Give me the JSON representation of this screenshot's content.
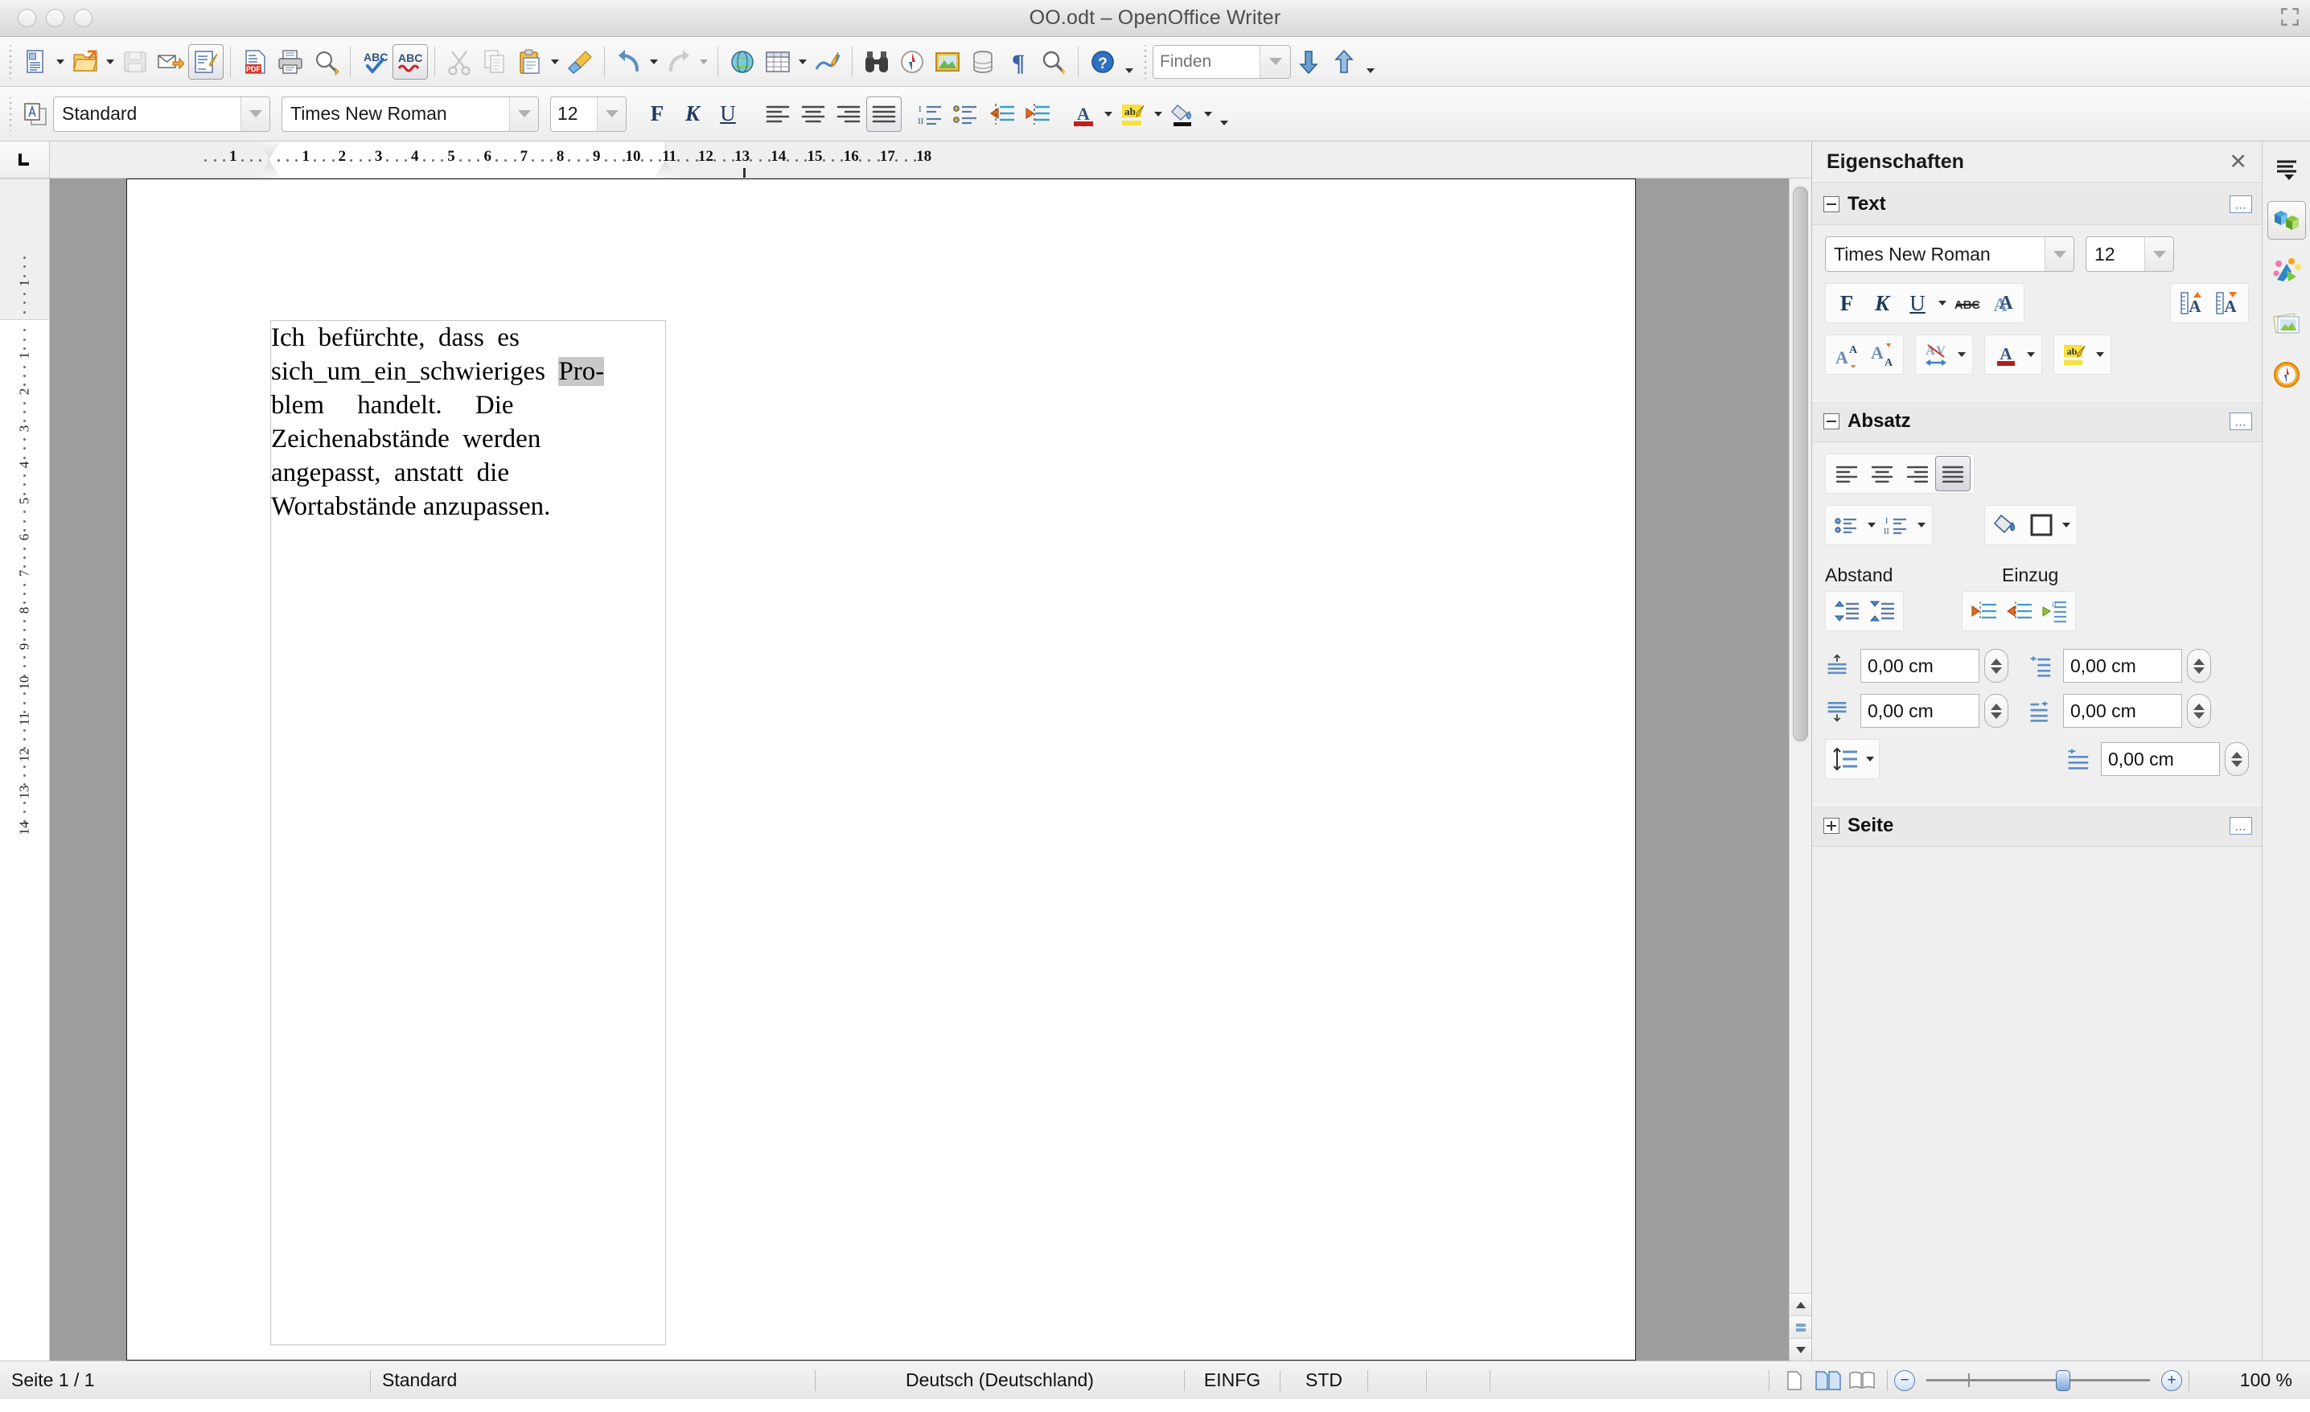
{
  "window": {
    "title": "OO.odt – OpenOffice Writer",
    "controls": [
      "close",
      "minimize",
      "zoom"
    ]
  },
  "main_toolbar": {
    "buttons": [
      {
        "name": "new-document",
        "icon": "new-doc-icon",
        "label": "Neu",
        "dropdown": true,
        "state": "enabled"
      },
      {
        "name": "open-document",
        "icon": "open-folder-icon",
        "label": "Öffnen",
        "dropdown": true,
        "state": "enabled"
      },
      {
        "name": "save-document",
        "icon": "save-floppy-icon",
        "label": "Speichern",
        "state": "disabled"
      },
      {
        "name": "send-email",
        "icon": "email-icon",
        "label": "Dokument als E-Mail",
        "state": "enabled"
      },
      {
        "name": "edit-mode",
        "icon": "edit-pencil-icon",
        "label": "Bearbeiten",
        "state": "active"
      },
      {
        "name": "export-pdf",
        "icon": "pdf-icon",
        "label": "Direktes Exportieren als PDF",
        "state": "enabled"
      },
      {
        "name": "print-document",
        "icon": "printer-icon",
        "label": "Datei direkt drucken",
        "state": "enabled"
      },
      {
        "name": "print-preview",
        "icon": "print-preview-icon",
        "label": "Seitenansicht",
        "state": "enabled"
      },
      {
        "name": "spellcheck",
        "icon": "abc-check-icon",
        "label": "Rechtschreibung",
        "state": "enabled"
      },
      {
        "name": "autospellcheck",
        "icon": "abc-wave-icon",
        "label": "Automatische Rechtschreibprüfung",
        "state": "active"
      },
      {
        "name": "cut",
        "icon": "scissors-icon",
        "label": "Ausschneiden",
        "state": "disabled"
      },
      {
        "name": "copy",
        "icon": "copy-icon",
        "label": "Kopieren",
        "state": "disabled"
      },
      {
        "name": "paste",
        "icon": "clipboard-icon",
        "label": "Einfügen",
        "dropdown": true,
        "state": "enabled"
      },
      {
        "name": "clone-formatting",
        "icon": "paintbrush-icon",
        "label": "Klonformatierung",
        "state": "enabled"
      },
      {
        "name": "undo",
        "icon": "undo-arrow-icon",
        "label": "Rückgängig",
        "dropdown": true,
        "state": "enabled"
      },
      {
        "name": "redo",
        "icon": "redo-arrow-icon",
        "label": "Wiederherstellen",
        "dropdown": true,
        "state": "disabled"
      },
      {
        "name": "hyperlink",
        "icon": "globe-icon",
        "label": "Hyperlink",
        "state": "enabled"
      },
      {
        "name": "insert-table",
        "icon": "table-grid-icon",
        "label": "Tabelle",
        "dropdown": true,
        "state": "enabled"
      },
      {
        "name": "show-draw-functions",
        "icon": "draw-pencil-icon",
        "label": "Zeichenfunktionen",
        "state": "enabled"
      },
      {
        "name": "find-replace",
        "icon": "binoculars-icon",
        "label": "Suchen & Ersetzen",
        "state": "enabled"
      },
      {
        "name": "navigator",
        "icon": "compass-icon",
        "label": "Navigator",
        "state": "enabled"
      },
      {
        "name": "gallery",
        "icon": "gallery-picture-icon",
        "label": "Gallery",
        "state": "enabled"
      },
      {
        "name": "data-sources",
        "icon": "database-icon",
        "label": "Datenquellen",
        "state": "enabled"
      },
      {
        "name": "formatting-marks",
        "icon": "pilcrow-icon",
        "label": "Formatierungszeichen",
        "state": "enabled"
      },
      {
        "name": "zoom",
        "icon": "magnifier-icon",
        "label": "Maßstab",
        "state": "enabled"
      },
      {
        "name": "help",
        "icon": "help-question-icon",
        "label": "Hilfe",
        "state": "enabled"
      }
    ],
    "find": {
      "placeholder": "Finden",
      "value": "",
      "find-next": "Abwärts suchen",
      "find-prev": "Aufwärts suchen"
    }
  },
  "format_toolbar": {
    "style_apply_icon": "style-apply-icon",
    "paragraph_style": "Standard",
    "font_name": "Times New Roman",
    "font_size": "12",
    "bold": "F",
    "italic": "K",
    "underline": "U",
    "buttons": [
      {
        "name": "align-left",
        "icon": "align-left-icon",
        "state": "enabled"
      },
      {
        "name": "align-center",
        "icon": "align-center-icon",
        "state": "enabled"
      },
      {
        "name": "align-right",
        "icon": "align-right-icon",
        "state": "enabled"
      },
      {
        "name": "align-justified",
        "icon": "align-justify-icon",
        "state": "active"
      },
      {
        "name": "numbered-list",
        "icon": "numbered-list-icon",
        "state": "enabled"
      },
      {
        "name": "bullet-list",
        "icon": "bullet-list-icon",
        "state": "enabled"
      },
      {
        "name": "decrease-indent",
        "icon": "decrease-indent-icon",
        "state": "enabled"
      },
      {
        "name": "increase-indent",
        "icon": "increase-indent-icon",
        "state": "enabled"
      },
      {
        "name": "font-color",
        "icon": "font-color-icon",
        "dropdown": true,
        "state": "enabled"
      },
      {
        "name": "highlighting",
        "icon": "highlight-icon",
        "dropdown": true,
        "state": "enabled"
      },
      {
        "name": "background-color",
        "icon": "background-color-icon",
        "dropdown": true,
        "state": "enabled"
      }
    ]
  },
  "ruler": {
    "horizontal_ticks": [
      "1",
      "1",
      "2",
      "3",
      "4",
      "5",
      "6",
      "7",
      "8",
      "9",
      "10",
      "11",
      "12",
      "13",
      "14",
      "15",
      "16",
      "17",
      "18"
    ],
    "vertical_ticks": [
      "1",
      "1",
      "2",
      "3",
      "4",
      "5",
      "6",
      "7",
      "8",
      "9",
      "10",
      "11",
      "12",
      "13",
      "14"
    ],
    "unit": "cm",
    "tab-stop-selector": "tab-left-icon"
  },
  "document": {
    "lines": [
      "Ich  befürchte,  dass  es",
      "sich_um_ein_schwieriges  Pro-",
      "blem     handelt.     Die",
      "Zeichenabstände  werden",
      "angepasst,  anstatt  die",
      "Wortabstände anzupassen."
    ],
    "full_text": "Ich befürchte, dass es sich_um_ein_schwieriges Problem handelt. Die Zeichenabstände werden angepasst, anstatt die Wortabstände anzupassen.",
    "alignment": "justified",
    "font": "Times New Roman",
    "size": "12"
  },
  "sidebar": {
    "title": "Eigenschaften",
    "close_icon": "close-icon",
    "sections": [
      {
        "name": "text",
        "label": "Text",
        "expanded": true,
        "font_name": "Times New Roman",
        "font_size": "12",
        "bold": "F",
        "italic": "K",
        "underline": "U",
        "buttons": [
          {
            "name": "bold",
            "icon": "bold-icon"
          },
          {
            "name": "italic",
            "icon": "italic-icon"
          },
          {
            "name": "underline",
            "icon": "underline-icon"
          },
          {
            "name": "strikethrough",
            "icon": "strikethrough-icon"
          },
          {
            "name": "shadow",
            "icon": "shadow-text-icon"
          },
          {
            "name": "increase-font-size",
            "icon": "grow-font-icon"
          },
          {
            "name": "decrease-font-size",
            "icon": "shrink-font-icon"
          },
          {
            "name": "superscript",
            "icon": "superscript-icon"
          },
          {
            "name": "subscript",
            "icon": "subscript-icon"
          },
          {
            "name": "character-spacing",
            "icon": "character-spacing-icon"
          },
          {
            "name": "font-color",
            "icon": "font-color-icon"
          },
          {
            "name": "highlighting",
            "icon": "highlight-icon"
          }
        ]
      },
      {
        "name": "paragraph",
        "label": "Absatz",
        "expanded": true,
        "alignment_buttons": [
          {
            "name": "align-left",
            "icon": "align-left-icon",
            "active": false
          },
          {
            "name": "align-center",
            "icon": "align-center-icon",
            "active": false
          },
          {
            "name": "align-right",
            "icon": "align-right-icon",
            "active": false
          },
          {
            "name": "align-justified",
            "icon": "align-justify-icon",
            "active": true
          }
        ],
        "list_buttons": [
          {
            "name": "bullet-list",
            "icon": "bullet-list-icon",
            "dropdown": true
          },
          {
            "name": "numbered-list",
            "icon": "numbered-list-icon",
            "dropdown": true
          }
        ],
        "background_buttons": [
          {
            "name": "paragraph-background-color",
            "icon": "paint-can-icon"
          },
          {
            "name": "paragraph-borders",
            "icon": "borders-icon",
            "dropdown": true
          }
        ],
        "spacing_label": "Abstand",
        "indent_label": "Einzug",
        "spacing_buttons": [
          {
            "name": "increase-paragraph-spacing",
            "icon": "increase-spacing-icon"
          },
          {
            "name": "decrease-paragraph-spacing",
            "icon": "decrease-spacing-icon"
          }
        ],
        "indent_buttons": [
          {
            "name": "increase-indent",
            "icon": "increase-indent-icon"
          },
          {
            "name": "decrease-indent",
            "icon": "decrease-indent-icon"
          },
          {
            "name": "hanging-indent",
            "icon": "hanging-indent-icon"
          }
        ],
        "fields": [
          {
            "name": "spacing-above-paragraph",
            "icon": "space-above-icon",
            "value": "0,00 cm"
          },
          {
            "name": "indent-before-text",
            "icon": "indent-before-icon",
            "value": "0,00 cm"
          },
          {
            "name": "spacing-below-paragraph",
            "icon": "space-below-icon",
            "value": "0,00 cm"
          },
          {
            "name": "indent-after-text",
            "icon": "indent-after-icon",
            "value": "0,00 cm"
          },
          {
            "name": "first-line-indent",
            "icon": "first-line-indent-icon",
            "value": "0,00 cm"
          }
        ],
        "line_spacing": {
          "name": "line-spacing",
          "icon": "line-spacing-icon",
          "dropdown": true
        }
      },
      {
        "name": "page",
        "label": "Seite",
        "expanded": false
      }
    ],
    "tabs": [
      {
        "name": "sidebar-settings",
        "icon": "sidebar-menu-icon",
        "active": false
      },
      {
        "name": "tab-properties",
        "icon": "properties-cubes-icon",
        "active": true
      },
      {
        "name": "tab-styles",
        "icon": "styles-icon",
        "active": false
      },
      {
        "name": "tab-gallery",
        "icon": "gallery-icon",
        "active": false
      },
      {
        "name": "tab-navigator",
        "icon": "navigator-compass-icon",
        "active": false
      }
    ]
  },
  "statusbar": {
    "page": "Seite 1 / 1",
    "page_style": "Standard",
    "language": "Deutsch (Deutschland)",
    "insert_mode": "EINFG",
    "selection_mode": "STD",
    "view_layouts": [
      {
        "name": "single-page-view",
        "icon": "single-page-icon",
        "active": false
      },
      {
        "name": "multi-page-view",
        "icon": "multi-page-icon",
        "active": true
      },
      {
        "name": "book-view",
        "icon": "book-view-icon",
        "active": false
      }
    ],
    "zoom_out": "−",
    "zoom_in": "+",
    "zoom_value": "100 %",
    "zoom_percent": 100
  },
  "colors": {
    "accent": "#3a5a92",
    "window_bg": "#efefef",
    "page_gray": "#9d9d9d",
    "toolbar_top": "#fbfbfb",
    "toolbar_bottom": "#ededed"
  }
}
